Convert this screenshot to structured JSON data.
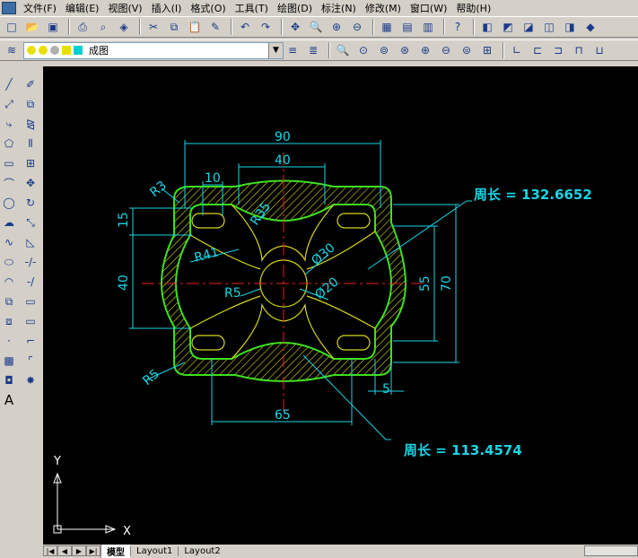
{
  "menu": {
    "items": [
      "文件(F)",
      "编辑(E)",
      "视图(V)",
      "插入(I)",
      "格式(O)",
      "工具(T)",
      "绘图(D)",
      "标注(N)",
      "修改(M)",
      "窗口(W)",
      "帮助(H)"
    ]
  },
  "layer": {
    "name": "成图"
  },
  "drawing": {
    "dims": {
      "width90": "90",
      "width40": "40",
      "width10": "10",
      "r3": "R3",
      "r35": "R35",
      "h15": "15",
      "h40": "40",
      "r41": "R41",
      "d30": "Ø30",
      "r5_center": "R5",
      "d20": "Ø20",
      "h55": "55",
      "h70": "70",
      "r5_corner": "R5",
      "w5": "5",
      "w65": "65"
    },
    "perimeter_top": "周长 = 132.6652",
    "perimeter_bottom": "周长 = 113.4574",
    "ucs_y": "Y",
    "ucs_x": "X"
  },
  "tabs": {
    "model": "模型",
    "layout1": "Layout1",
    "layout2": "Layout2"
  },
  "colors": {
    "outline": "#3ee01f",
    "hatch": "#d7d71c",
    "dim": "#19d6e6",
    "center": "#e62020",
    "note": "#19d6e6"
  }
}
